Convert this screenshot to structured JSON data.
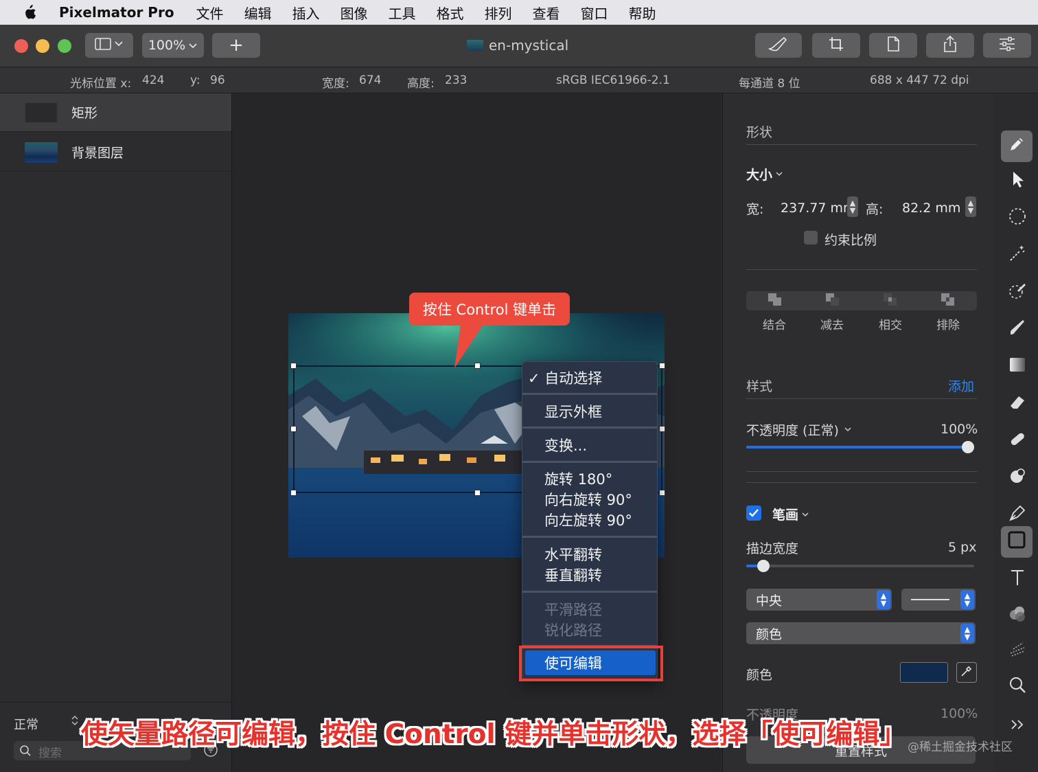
{
  "menubar": {
    "app_name": "Pixelmator Pro",
    "items": [
      "文件",
      "编辑",
      "插入",
      "图像",
      "工具",
      "格式",
      "排列",
      "查看",
      "窗口",
      "帮助"
    ]
  },
  "toolbar": {
    "zoom": "100%",
    "add_label": "+",
    "doc_title": "en-mystical",
    "icons": [
      "sidebar-toggle-icon",
      "brush-icon",
      "crop-icon",
      "document-icon",
      "share-icon",
      "sliders-icon"
    ]
  },
  "infobar": {
    "cursor_x_label": "光标位置 x:",
    "cursor_x": "424",
    "cursor_y_label": "y:",
    "cursor_y": "96",
    "width_label": "宽度:",
    "width": "674",
    "height_label": "高度:",
    "height": "233",
    "color_profile": "sRGB IEC61966-2.1",
    "bit_depth": "每通道 8 位",
    "dimensions": "688 x 447 72 dpi"
  },
  "layers": {
    "items": [
      {
        "name": "矩形",
        "selected": true
      },
      {
        "name": "背景图层",
        "selected": false
      }
    ],
    "blend_mode": "正常",
    "search_placeholder": "搜索"
  },
  "callout": {
    "text": "按住 Control 键单击"
  },
  "context_menu": {
    "items": [
      {
        "label": "✓ 自动选择",
        "enabled": true
      },
      {
        "label": "显示外框",
        "enabled": true
      },
      {
        "label": "变换...",
        "enabled": true
      },
      {
        "label": "旋转 180°",
        "enabled": true
      },
      {
        "label": "向右旋转 90°",
        "enabled": true
      },
      {
        "label": "向左旋转 90°",
        "enabled": true
      },
      {
        "label": "水平翻转",
        "enabled": true
      },
      {
        "label": "垂直翻转",
        "enabled": true
      },
      {
        "label": "平滑路径",
        "enabled": false
      },
      {
        "label": "锐化路径",
        "enabled": false
      },
      {
        "label": "使可编辑",
        "enabled": true,
        "highlighted": true
      }
    ]
  },
  "inspector": {
    "shape_title": "形状",
    "size_label": "大小",
    "width_label": "宽:",
    "width_value": "237.77 mr",
    "height_label": "高:",
    "height_value": "82.2 mm",
    "constrain_label": "约束比例",
    "constrain_checked": false,
    "bool_ops": [
      "结合",
      "减去",
      "相交",
      "排除"
    ],
    "style_title": "样式",
    "style_add": "添加",
    "opacity_label": "不透明度 (正常)",
    "opacity_value": "100%",
    "opacity_level": 1.0,
    "stroke_label": "笔画",
    "stroke_checked": true,
    "stroke_width_label": "描边宽度",
    "stroke_width_value": "5 px",
    "stroke_width_level": 0.05,
    "stroke_position": "中央",
    "stroke_fill_type": "颜色",
    "color_label": "颜色",
    "color_swatch": "#0f2a4d",
    "opacity2_label": "不透明度",
    "opacity2_value": "100%",
    "bottom_button": "重置样式"
  },
  "tools": [
    "style-icon",
    "arrow-icon",
    "selection-icon",
    "magic-wand-icon",
    "paint-select-icon",
    "paint-brush-icon",
    "gradient-icon",
    "eraser-icon",
    "repair-icon",
    "retouch-icon",
    "pen-icon",
    "shape-icon",
    "text-icon",
    "color-adjust-icon",
    "effects-icon",
    "zoom-icon",
    "more-icon"
  ],
  "caption": "使矢量路径可编辑，按住 Control 键并单击形状，选择「使可编辑」",
  "watermark": "@稀土掘金技术社区",
  "colors": {
    "accent_blue": "#1560c9",
    "callout_red": "#ec4a3d",
    "highlight_frame": "#e8413a",
    "caption_red": "#e5322d"
  }
}
